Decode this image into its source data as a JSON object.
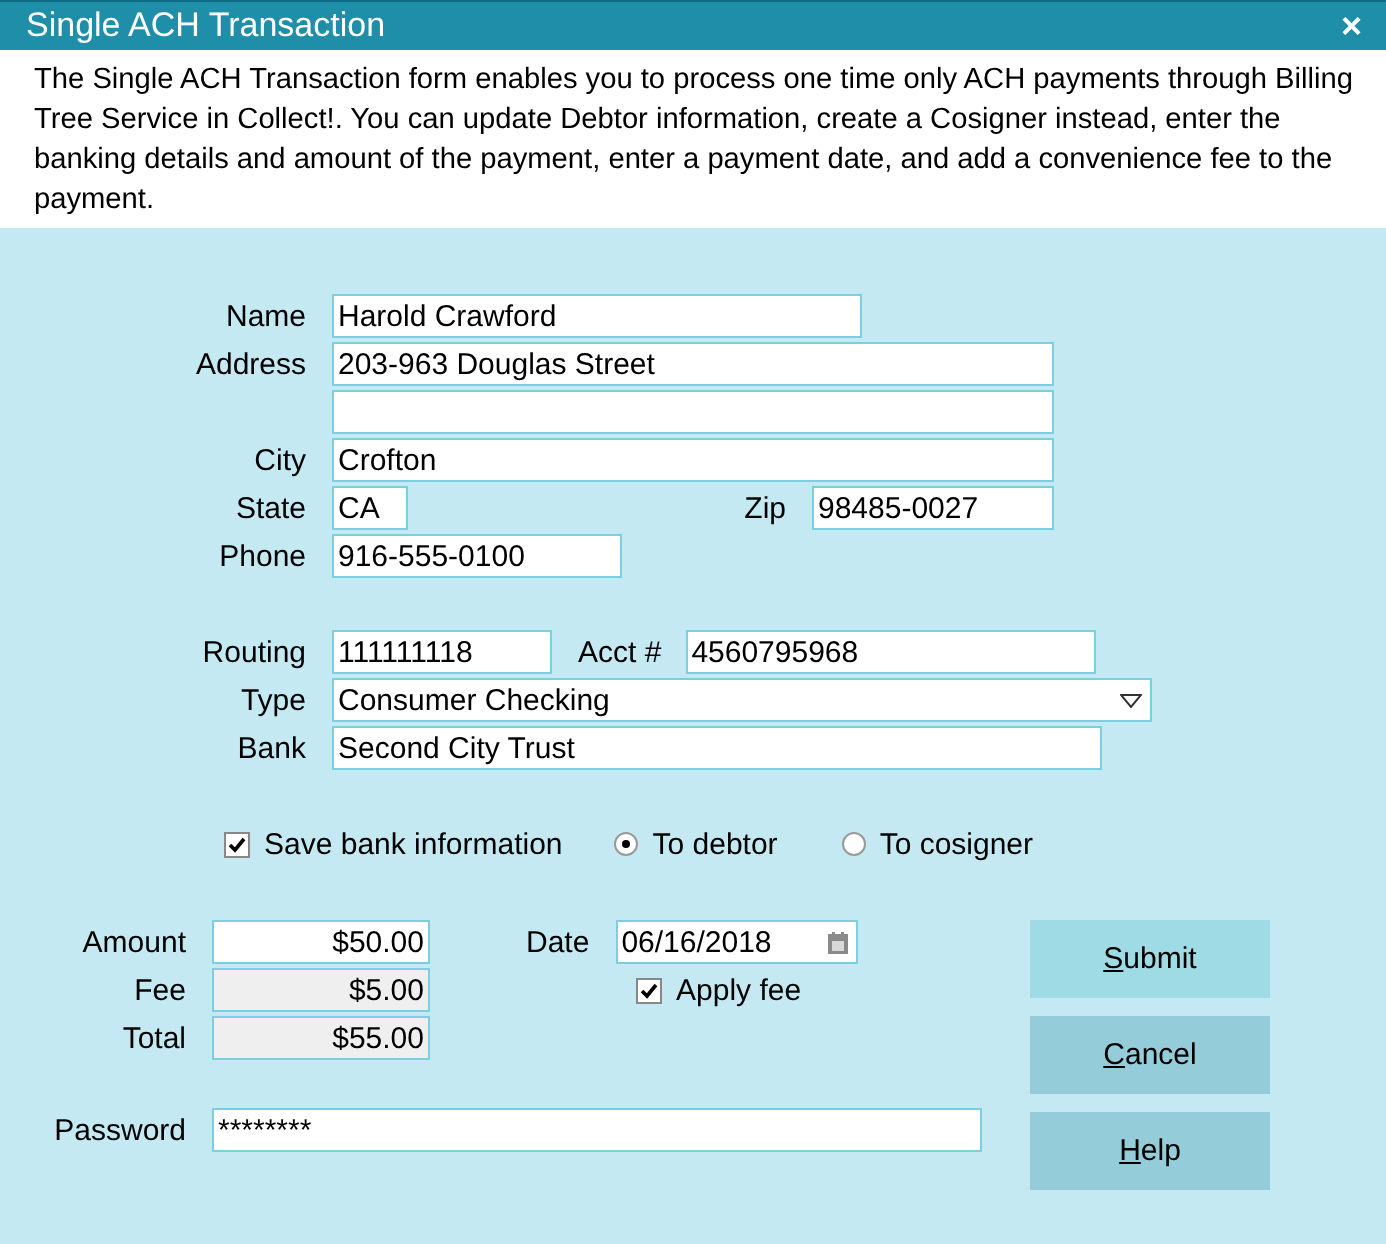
{
  "window": {
    "title": "Single ACH Transaction",
    "close": "×"
  },
  "description": "The Single ACH Transaction form enables you to process one time only ACH payments through Billing Tree Service in Collect!. You can update Debtor information, create a Cosigner instead, enter the banking details and amount of the payment, enter a payment date, and add a convenience fee to the payment.",
  "debtor": {
    "name": {
      "label": "Name",
      "value": "Harold Crawford"
    },
    "address": {
      "label": "Address",
      "lines": [
        "203-963 Douglas Street"
      ]
    },
    "city": {
      "label": "City",
      "value": "Crofton"
    },
    "state": {
      "label": "State",
      "value": "CA"
    },
    "zip": {
      "label": "Zip",
      "value": "98485-0027"
    },
    "phone": {
      "label": "Phone",
      "value": "916-555-0100"
    }
  },
  "bank": {
    "routing": {
      "label": "Routing",
      "value": "111111118"
    },
    "account": {
      "label": "Acct #",
      "value": "4560795968"
    },
    "type": {
      "label": "Type",
      "value": "Consumer Checking"
    },
    "bank": {
      "label": "Bank",
      "value": "Second City Trust"
    }
  },
  "save_options": {
    "save": {
      "label": "Save bank information",
      "checked": true
    },
    "targets": [
      {
        "label": "To debtor",
        "selected": true
      },
      {
        "label": "To cosigner",
        "selected": false
      }
    ]
  },
  "payment": {
    "amount": {
      "label": "Amount",
      "value": "$50.00",
      "readonly": false
    },
    "fee": {
      "label": "Fee",
      "value": "$5.00",
      "readonly": true
    },
    "total": {
      "label": "Total",
      "value": "$55.00",
      "readonly": true
    },
    "date": {
      "label": "Date",
      "value": "06/16/2018"
    },
    "apply_fee": {
      "label": "Apply fee",
      "checked": true
    },
    "password": {
      "label": "Password",
      "value": "********"
    }
  },
  "buttons": [
    {
      "mnemonic": "S",
      "rest": "ubmit",
      "default": true
    },
    {
      "mnemonic": "C",
      "rest": "ancel",
      "default": false
    },
    {
      "mnemonic": "H",
      "rest": "elp",
      "default": false
    }
  ]
}
